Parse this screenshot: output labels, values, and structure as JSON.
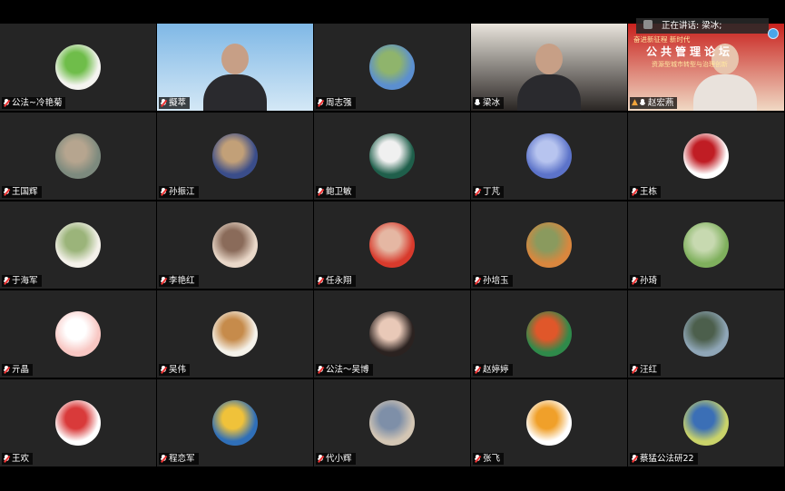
{
  "speaker_bar": {
    "text": "正在讲话: 梁冰;"
  },
  "banner": {
    "line1": "奋进新征程 新时代",
    "line2": "公共管理论坛",
    "line3": "资源型城市转型与治理创新"
  },
  "participants": [
    {
      "name": "公法~冷艳菊",
      "type": "avatar",
      "colors": [
        "#f4f4f0",
        "#6fbd4a"
      ]
    },
    {
      "name": "擬萃",
      "type": "video",
      "colors": [
        "#7fb8e6",
        "#d4e8f6"
      ]
    },
    {
      "name": "周志强",
      "type": "avatar",
      "colors": [
        "#5b8fd0",
        "#8fb46c"
      ]
    },
    {
      "name": "梁冰",
      "type": "video",
      "colors": [
        "#e9e4dc",
        "#2a2624"
      ],
      "active": true
    },
    {
      "name": "赵宏燕",
      "type": "video",
      "colors": [
        "#c8211d",
        "#f0d9c4"
      ],
      "host": true
    },
    {
      "name": "王国辉",
      "type": "avatar",
      "colors": [
        "#7d8a7e",
        "#b6a58f"
      ]
    },
    {
      "name": "孙振江",
      "type": "avatar",
      "colors": [
        "#3a4d8a",
        "#c2a078"
      ]
    },
    {
      "name": "鲍卫敏",
      "type": "avatar",
      "colors": [
        "#1f5f4b",
        "#f0f0f0"
      ]
    },
    {
      "name": "丁芃",
      "type": "avatar",
      "colors": [
        "#5c73c9",
        "#b7c4ef"
      ]
    },
    {
      "name": "王栋",
      "type": "avatar",
      "colors": [
        "#ffffff",
        "#c01d24"
      ]
    },
    {
      "name": "于海军",
      "type": "avatar",
      "colors": [
        "#f4f1ea",
        "#9bb47a"
      ]
    },
    {
      "name": "李艳红",
      "type": "avatar",
      "colors": [
        "#e9d8c9",
        "#8a6b5a"
      ]
    },
    {
      "name": "任永翔",
      "type": "avatar",
      "colors": [
        "#d83a2c",
        "#e5b7a3"
      ]
    },
    {
      "name": "孙培玉",
      "type": "avatar",
      "colors": [
        "#d9873e",
        "#8a9a5e"
      ]
    },
    {
      "name": "孙琦",
      "type": "avatar",
      "colors": [
        "#7fb05d",
        "#c7d9b0"
      ]
    },
    {
      "name": "亓晶",
      "type": "avatar",
      "colors": [
        "#f8c7c3",
        "#ffffff"
      ]
    },
    {
      "name": "吴伟",
      "type": "avatar",
      "colors": [
        "#f5f2ea",
        "#c68b4b"
      ]
    },
    {
      "name": "公法～吴博",
      "type": "avatar",
      "colors": [
        "#2b2220",
        "#e9c9b8"
      ]
    },
    {
      "name": "赵婷婷",
      "type": "avatar",
      "colors": [
        "#2f8a4a",
        "#e0572a"
      ]
    },
    {
      "name": "汪红",
      "type": "avatar",
      "colors": [
        "#8fa6b7",
        "#4c5f4c"
      ]
    },
    {
      "name": "王欢",
      "type": "avatar",
      "colors": [
        "#ffffff",
        "#d93a3a"
      ]
    },
    {
      "name": "程恋军",
      "type": "avatar",
      "colors": [
        "#2f6fb8",
        "#f0c23a"
      ]
    },
    {
      "name": "代小辉",
      "type": "avatar",
      "colors": [
        "#d3c6b4",
        "#7e8fa8"
      ]
    },
    {
      "name": "张飞",
      "type": "avatar",
      "colors": [
        "#ffffff",
        "#f0a02a"
      ]
    },
    {
      "name": "蔡猛公法研22",
      "type": "avatar",
      "colors": [
        "#c9d36a",
        "#3b6fb6"
      ]
    }
  ]
}
